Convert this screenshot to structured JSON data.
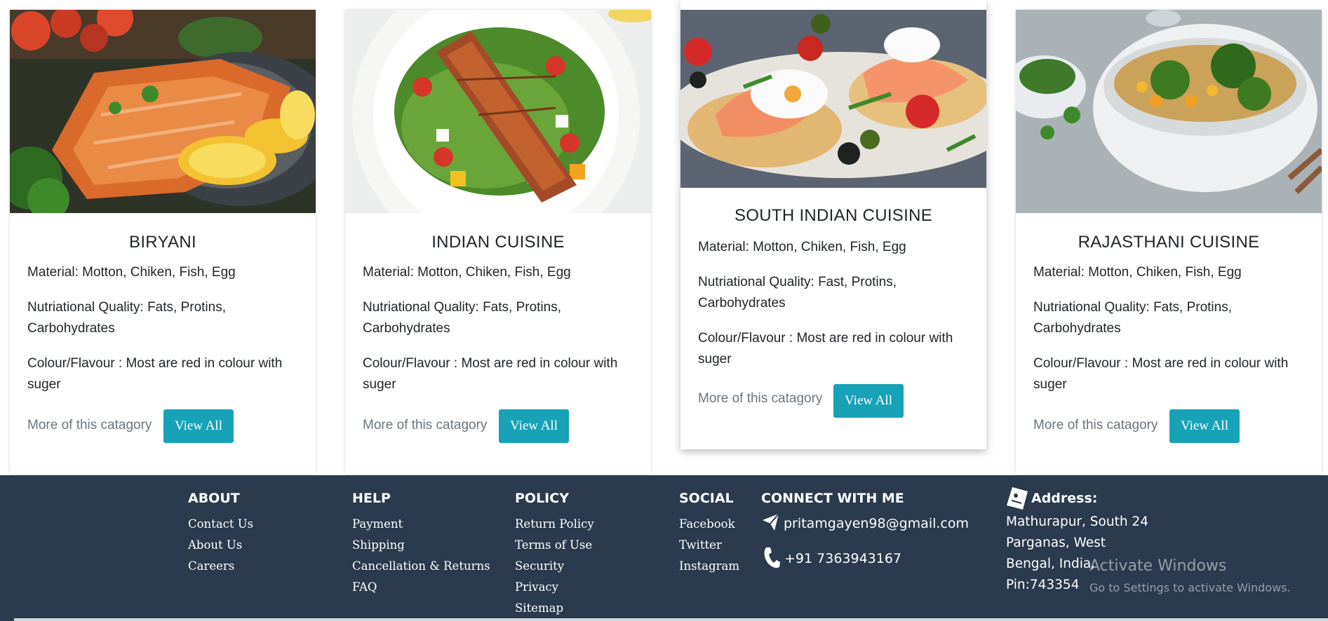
{
  "cards": [
    {
      "title": "BIRYANI",
      "material": "Material: Motton, Chiken, Fish, Egg",
      "nutrition": "Nutriational Quality: Fats, Protins, Carbohydrates",
      "colour": "Colour/Flavour : Most are red in colour with suger",
      "more": "More of this catagory",
      "button": "View All"
    },
    {
      "title": "INDIAN CUISINE",
      "material": "Material: Motton, Chiken, Fish, Egg",
      "nutrition": "Nutriational Quality: Fats, Protins, Carbohydrates",
      "colour": "Colour/Flavour : Most are red in colour with suger",
      "more": "More of this catagory",
      "button": "View All"
    },
    {
      "title": "SOUTH INDIAN CUISINE",
      "material": "Material: Motton, Chiken, Fish, Egg",
      "nutrition": "Nutriational Quality: Fast, Protins, Carbohydrates",
      "colour": "Colour/Flavour : Most are red in colour with suger",
      "more": "More of this catagory",
      "button": "View All"
    },
    {
      "title": "RAJASTHANI CUISINE",
      "material": "Material: Motton, Chiken, Fish, Egg",
      "nutrition": "Nutriational Quality: Fats, Protins, Carbohydrates",
      "colour": "Colour/Flavour : Most are red in colour with suger",
      "more": "More of this catagory",
      "button": "View All"
    }
  ],
  "footer": {
    "about": {
      "heading": "ABOUT",
      "links": [
        "Contact Us",
        "About Us",
        "Careers"
      ]
    },
    "help": {
      "heading": "HELP",
      "links": [
        "Payment",
        "Shipping",
        "Cancellation & Returns",
        "FAQ"
      ]
    },
    "policy": {
      "heading": "POLICY",
      "links": [
        "Return Policy",
        "Terms of Use",
        "Security",
        "Privacy",
        "Sitemap"
      ]
    },
    "social": {
      "heading": "SOCIAL",
      "links": [
        "Facebook",
        "Twitter",
        "Instagram"
      ]
    },
    "connect": {
      "heading": "CONNECT WITH ME",
      "email": "pritamgayen98@gmail.com",
      "phone": "+91 7363943167"
    },
    "address": {
      "heading": "Address:",
      "lines": [
        "Mathurapur, South 24",
        "Parganas, West",
        "Bengal, India,",
        "Pin:743354"
      ]
    }
  },
  "watermark": {
    "title": "Activate Windows",
    "subtitle": "Go to Settings to activate Windows."
  },
  "icons": [
    "email-icon",
    "phone-icon",
    "address-card-icon"
  ],
  "colors": {
    "button": "#17a2b8",
    "footer_bg": "#2b3a4c",
    "muted_text": "#6c757d"
  }
}
